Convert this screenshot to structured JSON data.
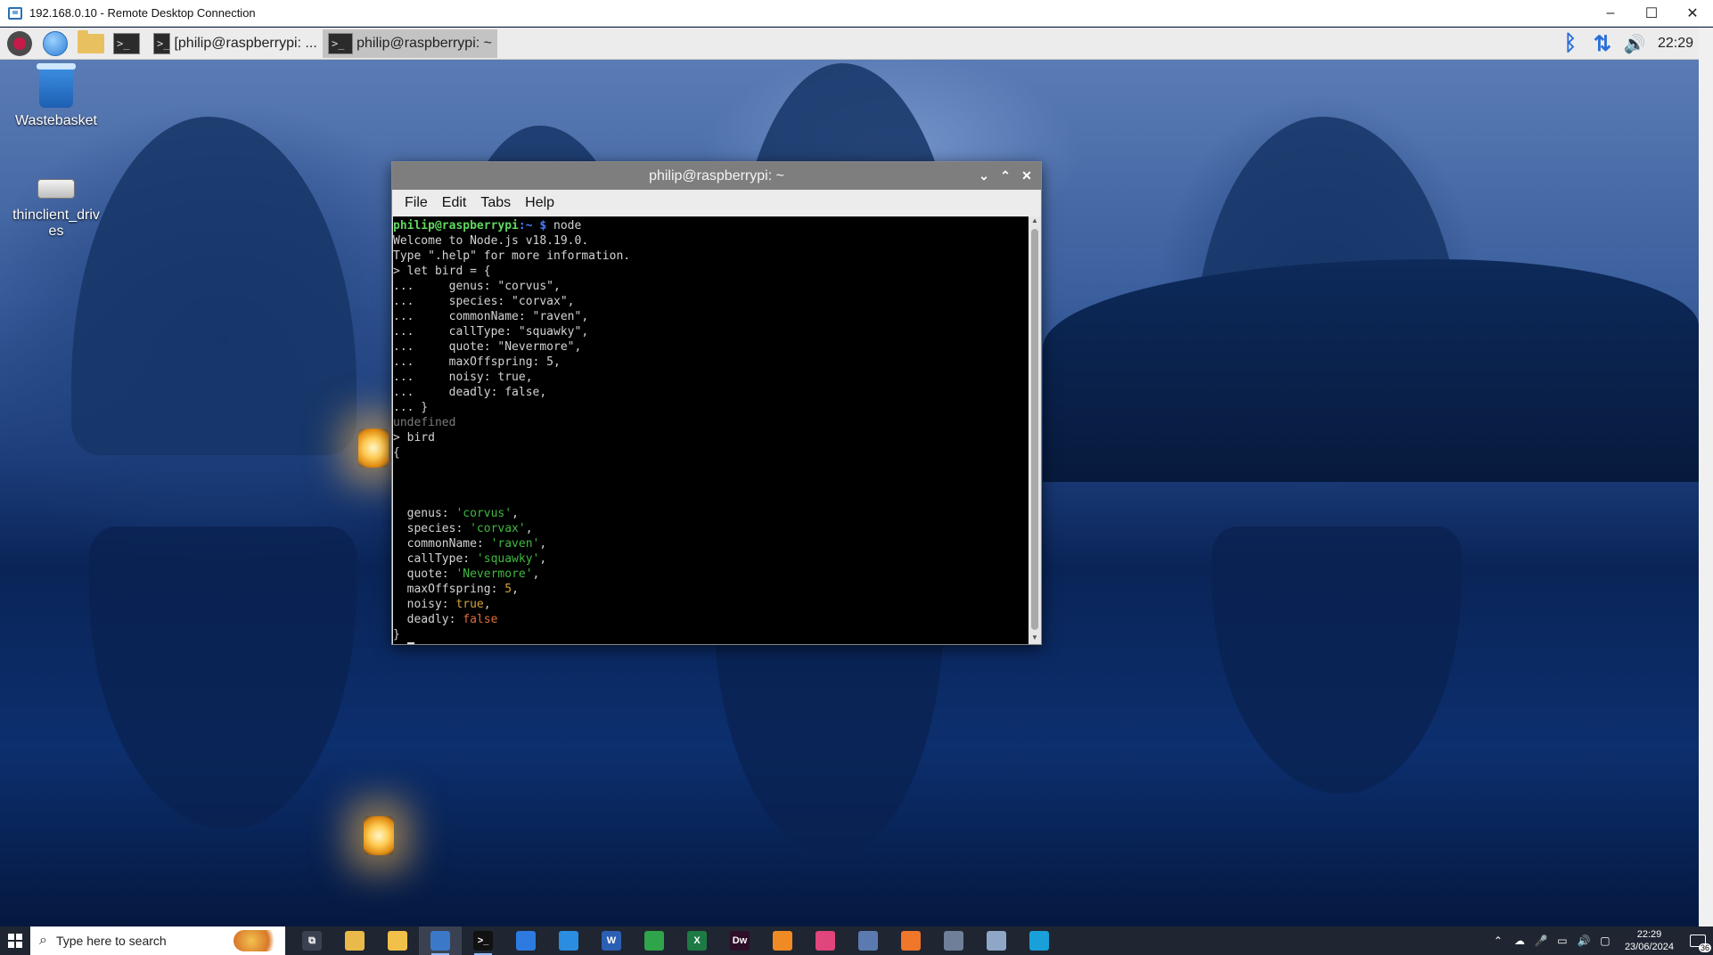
{
  "rdp": {
    "title": "192.168.0.10 - Remote Desktop Connection",
    "controls": [
      "–",
      "☐",
      "✕"
    ]
  },
  "pi_panel": {
    "tasks": [
      {
        "label": "[philip@raspberrypi: ..."
      },
      {
        "label": "philip@raspberrypi: ~"
      }
    ],
    "tray_icons": [
      "bluetooth-icon",
      "network-icon",
      "volume-icon"
    ],
    "clock": "22:29"
  },
  "desktop_icons": [
    {
      "label": "Wastebasket"
    },
    {
      "label": "thinclient_drives"
    }
  ],
  "terminal": {
    "title": "philip@raspberrypi: ~",
    "menu": [
      "File",
      "Edit",
      "Tabs",
      "Help"
    ],
    "prompt_user": "philip@raspberrypi",
    "prompt_path": ":~",
    "prompt_symbol": " $ ",
    "command": "node",
    "welcome": "Welcome to Node.js v18.19.0.",
    "help_hint": "Type \".help\" for more information.",
    "input_lines": [
      "> let bird = {",
      "...     genus: \"corvus\",",
      "...     species: \"corvax\",",
      "...     commonName: \"raven\",",
      "...     callType: \"squawky\",",
      "...     quote: \"Nevermore\",",
      "...     maxOffspring: 5,",
      "...     noisy: true,",
      "...     deadly: false,",
      "... }"
    ],
    "result_undefined": "undefined",
    "eval_command": "> bird",
    "open_brace": "{",
    "object_props": [
      {
        "key": "  genus: ",
        "value": "'corvus'",
        "kind": "str"
      },
      {
        "key": "  species: ",
        "value": "'corvax'",
        "kind": "str"
      },
      {
        "key": "  commonName: ",
        "value": "'raven'",
        "kind": "str"
      },
      {
        "key": "  callType: ",
        "value": "'squawky'",
        "kind": "str"
      },
      {
        "key": "  quote: ",
        "value": "'Nevermore'",
        "kind": "str"
      },
      {
        "key": "  maxOffspring: ",
        "value": "5",
        "kind": "num"
      },
      {
        "key": "  noisy: ",
        "value": "true",
        "kind": "bool"
      },
      {
        "key": "  deadly: ",
        "value": "false",
        "kind": "false"
      }
    ],
    "close_brace": "}",
    "final_prompt": "> "
  },
  "win_taskbar": {
    "search_placeholder": "Type here to search",
    "apps": [
      {
        "name": "task-view-icon",
        "glyph": "⧉",
        "color": "#3a4252"
      },
      {
        "name": "file-explorer-icon",
        "glyph": "",
        "color": "#e9b94a"
      },
      {
        "name": "folder-icon",
        "glyph": "",
        "color": "#f0c048"
      },
      {
        "name": "remote-desktop-icon",
        "glyph": "",
        "color": "#3c78c8"
      },
      {
        "name": "terminal-icon",
        "glyph": ">_",
        "color": "#111111"
      },
      {
        "name": "firefox-icon",
        "glyph": "",
        "color": "#2d7be0"
      },
      {
        "name": "vscode-icon",
        "glyph": "",
        "color": "#2a8de0"
      },
      {
        "name": "word-icon",
        "glyph": "W",
        "color": "#2b5fb4"
      },
      {
        "name": "snipping-icon",
        "glyph": "",
        "color": "#2fa44a"
      },
      {
        "name": "excel-icon",
        "glyph": "X",
        "color": "#1e7a44"
      },
      {
        "name": "dreamweaver-icon",
        "glyph": "Dw",
        "color": "#2e0f2a"
      },
      {
        "name": "app-orange-icon",
        "glyph": "",
        "color": "#f08a24"
      },
      {
        "name": "slack-icon",
        "glyph": "",
        "color": "#e0457b"
      },
      {
        "name": "notepad-icon",
        "glyph": "",
        "color": "#5b7bb0"
      },
      {
        "name": "postman-icon",
        "glyph": "",
        "color": "#f0762a"
      },
      {
        "name": "network-app-icon",
        "glyph": "",
        "color": "#6f7f99"
      },
      {
        "name": "paint-icon",
        "glyph": "",
        "color": "#8fa7c7"
      },
      {
        "name": "edge-icon",
        "glyph": "",
        "color": "#1aa0d8"
      }
    ],
    "tray_glyphs": [
      "⌃",
      "☁",
      "🎤",
      "▭",
      "🔊",
      "▢"
    ],
    "time": "22:29",
    "date": "23/06/2024",
    "notification_count": "36"
  }
}
